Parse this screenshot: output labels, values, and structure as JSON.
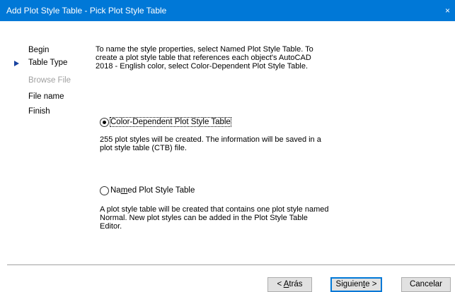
{
  "window": {
    "title": "Add Plot Style Table - Pick Plot Style Table",
    "close_glyph": "×"
  },
  "nav": {
    "items": [
      {
        "label": "Begin",
        "state": "normal"
      },
      {
        "label": "Table Type",
        "state": "current"
      },
      {
        "label": "Browse File",
        "state": "disabled"
      },
      {
        "label": "File name",
        "state": "normal"
      },
      {
        "label": "Finish",
        "state": "normal"
      }
    ],
    "current_indicator": "triangle-right-icon"
  },
  "intro": {
    "line1": "To name the style properties, select Named Plot Style Table. To",
    "line2": "create a plot style table that references each object's AutoCAD",
    "line3": "2018 - English color, select Color-Dependent Plot Style Table."
  },
  "options": {
    "color_dependent": {
      "label": "Color-Dependent Plot Style Table",
      "checked": true,
      "desc_line1": "255 plot styles will be created. The information will be saved in a",
      "desc_line2": "plot style table (CTB) file."
    },
    "named": {
      "label_pre": "Na",
      "label_accel": "m",
      "label_post": "ed Plot Style Table",
      "checked": false,
      "desc_line1": "A plot style table will be created that contains one plot style named",
      "desc_line2": "Normal.  New plot styles can be added in the Plot Style Table",
      "desc_line3": "Editor."
    }
  },
  "buttons": {
    "back_pre": "< ",
    "back_accel": "A",
    "back_post": "trás",
    "next_pre": "Siguien",
    "next_accel": "t",
    "next_post": "e >",
    "cancel": "Cancelar"
  },
  "colors": {
    "title_bar": "#0078d7",
    "nav_arrow": "#1a44a0",
    "disabled_text": "#a0a0a0"
  }
}
